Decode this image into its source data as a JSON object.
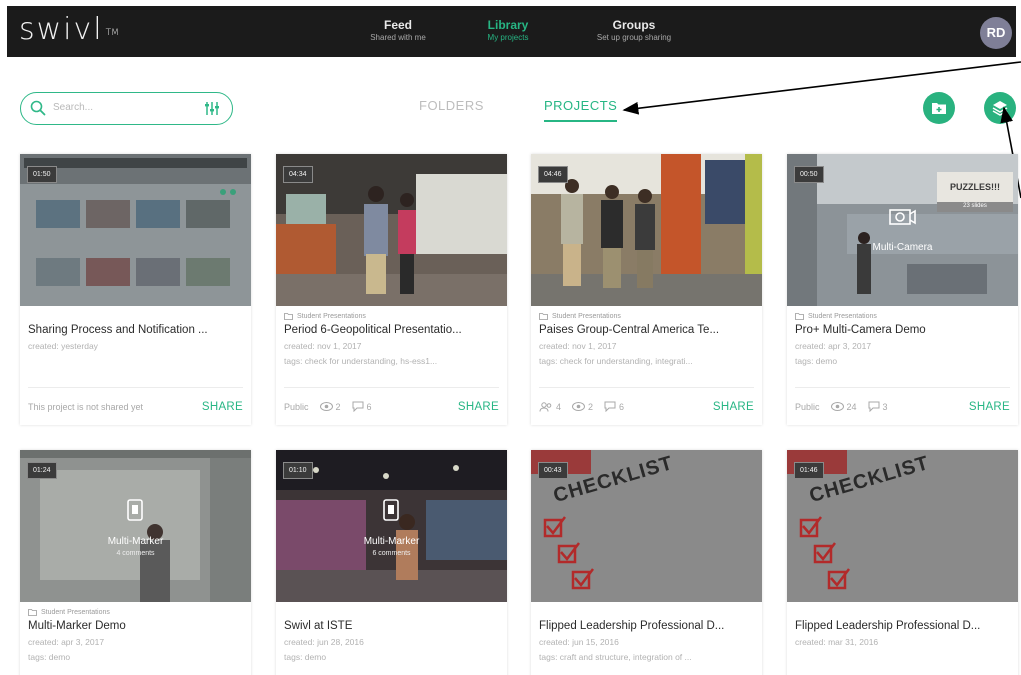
{
  "app": {
    "logo": "swivl",
    "logo_tm": "TM",
    "avatar_initials": "RD",
    "accent_color": "#27b684"
  },
  "nav": [
    {
      "title": "Feed",
      "subtitle": "Shared with me"
    },
    {
      "title": "Library",
      "subtitle": "My projects"
    },
    {
      "title": "Groups",
      "subtitle": "Set up group sharing"
    }
  ],
  "toolbar": {
    "search_placeholder": "Search...",
    "tab_folders": "FOLDERS",
    "tab_projects": "PROJECTS",
    "add_folder_icon": "folder-plus-icon",
    "layers_icon": "layers-icon"
  },
  "cards": [
    {
      "duration": "01:50",
      "folder": "",
      "title": "Sharing Process and Notification ...",
      "created": "created: yesterday",
      "tags": "",
      "status": "This project is not shared yet",
      "views": "",
      "comments": "",
      "participants": "",
      "share": "SHARE"
    },
    {
      "duration": "04:34",
      "folder": "Student Presentations",
      "title": "Period 6-Geopolitical Presentatio...",
      "created": "created: nov 1, 2017",
      "tags": "tags: check for understanding, hs-ess1...",
      "status": "Public",
      "views": "2",
      "comments": "6",
      "participants": "",
      "share": "SHARE"
    },
    {
      "duration": "04:46",
      "folder": "Student Presentations",
      "title": "Paises Group-Central America Te...",
      "created": "created: nov 1, 2017",
      "tags": "tags: check for understanding, integrati...",
      "status": "",
      "participants": "4",
      "views": "2",
      "comments": "6",
      "share": "SHARE"
    },
    {
      "duration": "00:50",
      "folder": "Student Presentations",
      "title": "Pro+ Multi-Camera Demo",
      "created": "created: apr 3, 2017",
      "tags": "tags: demo",
      "status": "Public",
      "views": "24",
      "comments": "3",
      "participants": "",
      "share": "SHARE",
      "overlay": "Multi-Camera",
      "slides_title": "PUZZLES!!!",
      "slides_count": "23 slides"
    },
    {
      "duration": "01:24",
      "folder": "Student Presentations",
      "title": "Multi-Marker Demo",
      "created": "created: apr 3, 2017",
      "tags": "tags: demo",
      "overlay": "Multi-Marker",
      "overlay_sub": "4 comments"
    },
    {
      "duration": "01:10",
      "folder": "",
      "title": "Swivl at ISTE",
      "created": "created: jun 28, 2016",
      "tags": "tags: demo",
      "overlay": "Multi-Marker",
      "overlay_sub": "6 comments"
    },
    {
      "duration": "00:43",
      "folder": "",
      "title": "Flipped Leadership Professional D...",
      "created": "created: jun 15, 2016",
      "tags": "tags: craft and structure, integration of ...",
      "checklist": "CHECKLIST"
    },
    {
      "duration": "01:46",
      "folder": "",
      "title": "Flipped Leadership Professional D...",
      "created": "created: mar 31, 2016",
      "tags": "",
      "checklist": "CHECKLIST"
    }
  ]
}
